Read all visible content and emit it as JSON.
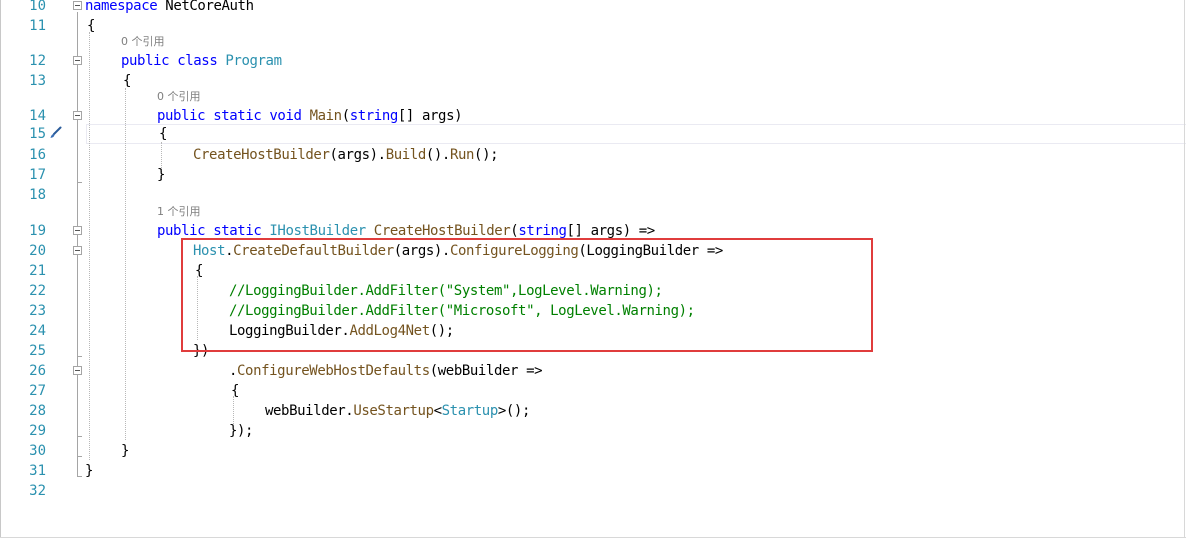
{
  "editor": {
    "line_numbers": [
      "10",
      "11",
      "12",
      "13",
      "14",
      "15",
      "16",
      "17",
      "18",
      "19",
      "20",
      "21",
      "22",
      "23",
      "24",
      "25",
      "26",
      "27",
      "28",
      "29",
      "30",
      "31",
      "32"
    ],
    "code_lens": {
      "program_refs": "0 个引用",
      "main_refs": "0 个引用",
      "create_host_builder_refs": "1 个引用"
    },
    "lines": {
      "l10": {
        "kw": "namespace",
        "name": " NetCoreAuth"
      },
      "l11": {
        "text": "{"
      },
      "l12": {
        "kw": "public class",
        "type": "Program"
      },
      "l13": {
        "text": "{"
      },
      "l14": {
        "kw1": "public static void",
        "fn": "Main",
        "p1": "(",
        "kw2": "string",
        "p2": "[] args)"
      },
      "l15": {
        "text": "{"
      },
      "l16": {
        "fn1": "CreateHostBuilder",
        "p1": "(args).",
        "fn2": "Build",
        "p2": "().",
        "fn3": "Run",
        "p3": "();"
      },
      "l17": {
        "text": "}"
      },
      "l19": {
        "kw": "public static",
        "type": "IHostBuilder",
        "fn": "CreateHostBuilder",
        "p1": "(",
        "kw2": "string",
        "p2": "[] args) =>"
      },
      "l20": {
        "type": "Host",
        "p1": ".",
        "fn1": "CreateDefaultBuilder",
        "p2": "(args).",
        "fn2": "ConfigureLogging",
        "p3": "(LoggingBuilder =>"
      },
      "l21": {
        "text": "{"
      },
      "l22": {
        "comment": "//LoggingBuilder.AddFilter(\"System\",LogLevel.Warning);"
      },
      "l23": {
        "comment": "//LoggingBuilder.AddFilter(\"Microsoft\", LogLevel.Warning);"
      },
      "l24": {
        "p1": "LoggingBuilder.",
        "fn": "AddLog4Net",
        "p2": "();"
      },
      "l25": {
        "text": "})"
      },
      "l26": {
        "p1": ".",
        "fn": "ConfigureWebHostDefaults",
        "p2": "(webBuilder =>"
      },
      "l27": {
        "text": "{"
      },
      "l28": {
        "p1": "webBuilder.",
        "fn": "UseStartup",
        "p2": "<",
        "type": "Startup",
        "p3": ">();"
      },
      "l29": {
        "text": "});"
      },
      "l30": {
        "text": "}"
      },
      "l31": {
        "text": "}"
      }
    },
    "icons": {
      "fold": "fold-collapse-icon",
      "edit": "pencil-brush-icon"
    },
    "colors": {
      "line_number": "#2b91af",
      "keyword": "#0000ff",
      "type": "#2b91af",
      "method": "#74531f",
      "comment": "#008000",
      "highlight_box": "#e03c3c"
    }
  }
}
